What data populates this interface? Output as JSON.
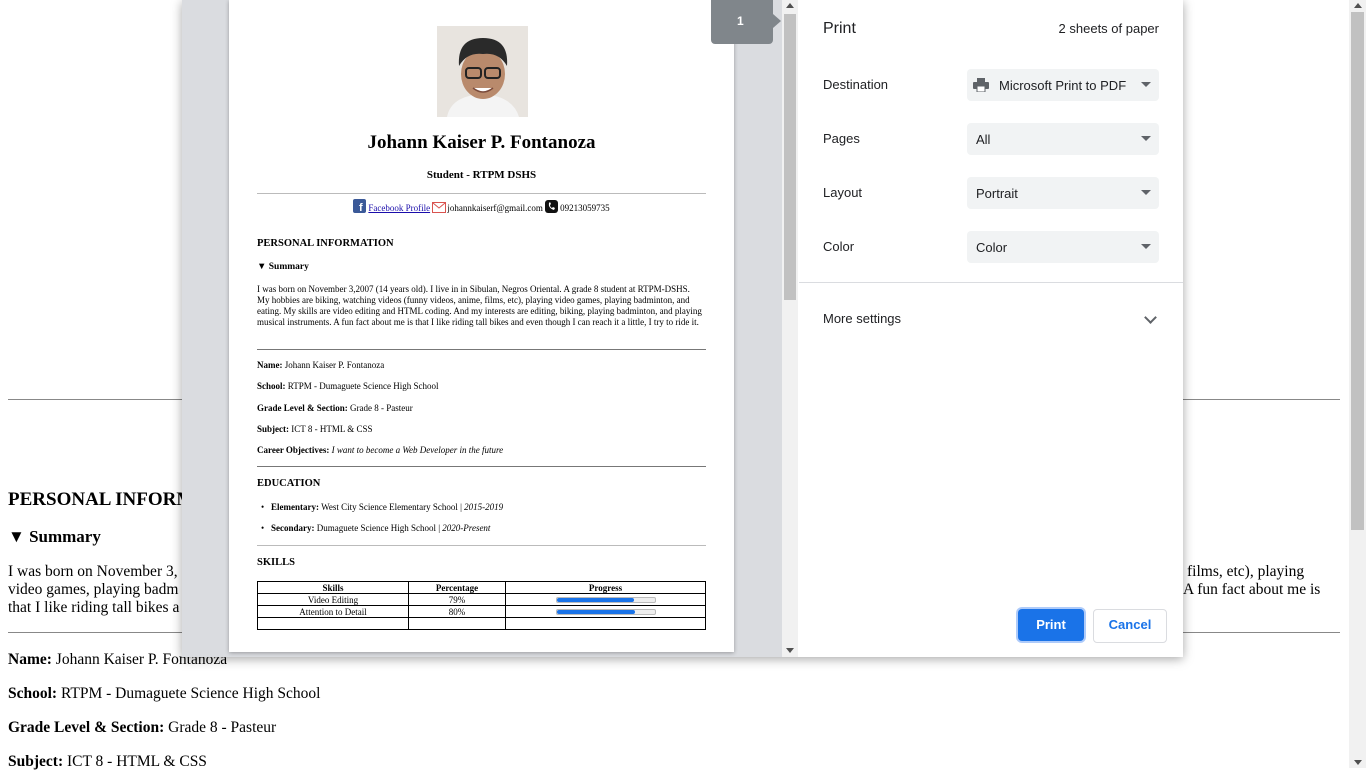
{
  "background": {
    "section_heading": "PERSONAL INFORMATION",
    "summary_label": "▼ Summary",
    "summary_left_lines": [
      "I was born on November 3,",
      "video games, playing badm",
      "that I like riding tall bikes a"
    ],
    "summary_right_lines": [
      "films, etc), playing",
      "A fun fact about me is"
    ],
    "fields": [
      {
        "label": "Name:",
        "value": "Johann Kaiser P. Fontanoza"
      },
      {
        "label": "School:",
        "value": "RTPM - Dumaguete Science High School"
      },
      {
        "label": "Grade Level & Section:",
        "value": "Grade 8 - Pasteur"
      },
      {
        "label": "Subject:",
        "value": "ICT 8 - HTML & CSS"
      }
    ]
  },
  "preview": {
    "page_number": "1",
    "name": "Johann Kaiser P. Fontanoza",
    "role": "Student - RTPM DSHS",
    "contact": {
      "facebook": "Facebook Profile",
      "email": "johannkaiserf@gmail.com",
      "phone": "09213059735"
    },
    "personal_heading": "PERSONAL INFORMATION",
    "summary_label": "▼ Summary",
    "summary_text": "I was born on November 3,2007 (14 years old). I live in in Sibulan, Negros Oriental. A grade 8 student at RTPM-DSHS. My hobbies are biking, watching videos (funny videos, anime, films, etc), playing video games, playing badminton, and eating. My skills are video editing and HTML coding. And my interests are editing, biking, playing badminton, and playing musical instruments. A fun fact about me is that I like riding tall bikes and even though I can reach it a little, I try to ride it.",
    "fields": [
      {
        "label": "Name:",
        "value": "Johann Kaiser P. Fontanoza"
      },
      {
        "label": "School:",
        "value": "RTPM - Dumaguete Science High School"
      },
      {
        "label": "Grade Level & Section:",
        "value": "Grade 8 - Pasteur"
      },
      {
        "label": "Subject:",
        "value": "ICT 8 - HTML & CSS"
      },
      {
        "label": "Career Objectives:",
        "value": "I want to become a Web Developer in the future"
      }
    ],
    "education_heading": "EDUCATION",
    "education": [
      {
        "label": "Elementary:",
        "school": "West City Science Elementary School |",
        "years": "2015-2019"
      },
      {
        "label": "Secondary:",
        "school": "Dumaguete Science High School |",
        "years": "2020-Present"
      }
    ],
    "skills_heading": "SKILLS",
    "skills_table": {
      "headers": [
        "Skills",
        "Percentage",
        "Progress"
      ],
      "rows": [
        {
          "skill": "Video Editing",
          "percent": "79%",
          "progress": 0.79
        },
        {
          "skill": "Attention to Detail",
          "percent": "80%",
          "progress": 0.8
        }
      ]
    }
  },
  "settings": {
    "title": "Print",
    "sheets": "2 sheets of paper",
    "destination_label": "Destination",
    "destination_value": "Microsoft Print to PDF",
    "pages_label": "Pages",
    "pages_value": "All",
    "layout_label": "Layout",
    "layout_value": "Portrait",
    "color_label": "Color",
    "color_value": "Color",
    "more_settings": "More settings",
    "print_button": "Print",
    "cancel_button": "Cancel"
  },
  "colors": {
    "accent": "#1a73e8",
    "preview_bg": "#dadce0",
    "page_badge": "#80868b"
  }
}
